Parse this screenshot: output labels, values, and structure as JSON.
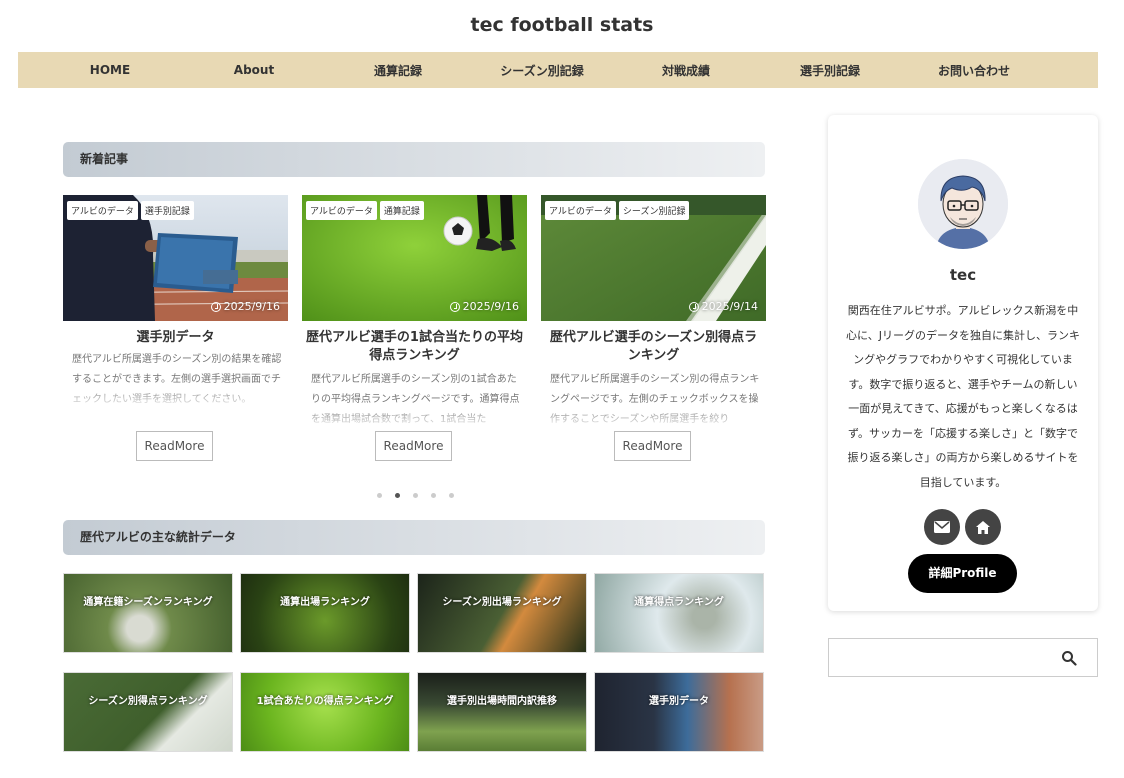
{
  "site": {
    "title": "tec football stats"
  },
  "nav": [
    "HOME",
    "About",
    "通算記録",
    "シーズン別記録",
    "対戦成績",
    "選手別記録",
    "お問い合わせ"
  ],
  "sections": {
    "new_articles": "新着記事",
    "stats": "歴代アルビの主な統計データ"
  },
  "articles": [
    {
      "tags": [
        "アルビのデータ",
        "選手別記録"
      ],
      "date": "2025/9/16",
      "title": "選手別データ",
      "desc": "歴代アルビ所属選手のシーズン別の結果を確認することができます。左側の選手選択画面でチェックしたい選手を選択してください。",
      "readmore": "ReadMore"
    },
    {
      "tags": [
        "アルビのデータ",
        "通算記録"
      ],
      "date": "2025/9/16",
      "title": "歴代アルビ選手の1試合当たりの平均得点ランキング",
      "desc": "歴代アルビ所属選手のシーズン別の1試合あたりの平均得点ランキングページです。通算得点を通算出場試合数で割って、1試合当た",
      "readmore": "ReadMore"
    },
    {
      "tags": [
        "アルビのデータ",
        "シーズン別記録"
      ],
      "date": "2025/9/14",
      "title": "歴代アルビ選手のシーズン別得点ランキング",
      "desc": "歴代アルビ所属選手のシーズン別の得点ランキングページです。左側のチェックボックスを操作することでシーズンや所属選手を絞り",
      "readmore": "ReadMore"
    }
  ],
  "slider": {
    "total": 5,
    "active": 1
  },
  "stat_tiles": [
    "通算在籍シーズンランキング",
    "通算出場ランキング",
    "シーズン別出場ランキング",
    "通算得点ランキング",
    "シーズン別得点ランキング",
    "1試合あたりの得点ランキング",
    "選手別出場時間内訳推移",
    "選手別データ"
  ],
  "profile": {
    "name": "tec",
    "bio": "関西在住アルビサポ。アルビレックス新潟を中心に、Jリーグのデータを独自に集計し、ランキングやグラフでわかりやすく可視化しています。数字で振り返ると、選手やチームの新しい一面が見えてきて、応援がもっと楽しくなるはず。サッカーを「応援する楽しさ」と「数字で振り返る楽しさ」の両方から楽しめるサイトを目指しています。",
    "button": "詳細Profile"
  },
  "search": {
    "placeholder": ""
  },
  "icons": {
    "mail": "mail-icon",
    "home": "home-icon",
    "search": "search-icon",
    "clock": "clock-icon"
  },
  "colors": {
    "nav_bg": "#e8d9b4",
    "heading_grad_start": "#c3cbd3",
    "profile_btn": "#000000"
  }
}
